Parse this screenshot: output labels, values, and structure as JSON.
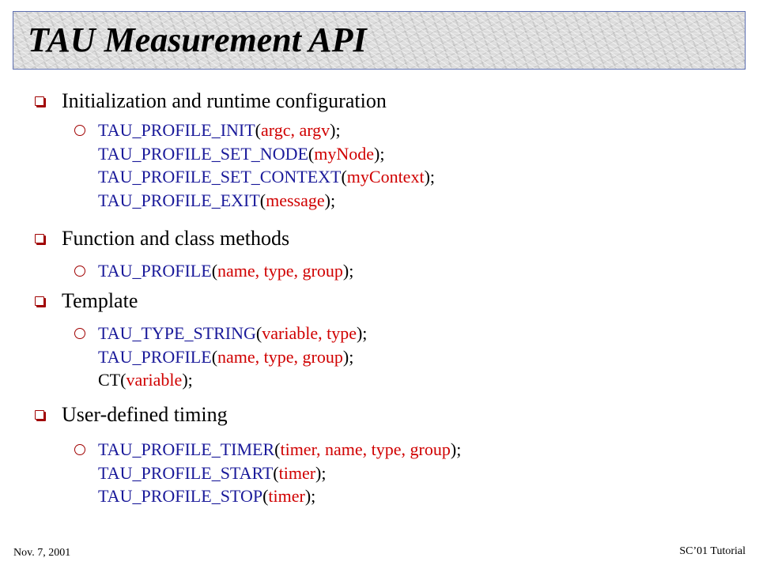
{
  "title": "TAU Measurement API",
  "sections": [
    {
      "heading": "Initialization and runtime configuration",
      "lines": [
        [
          {
            "fn": "TAU_PROFILE_INIT"
          },
          {
            "p": "("
          },
          {
            "arg": "argc, argv"
          },
          {
            "p": ");"
          }
        ],
        [
          {
            "fn": "TAU_PROFILE_SET_NODE"
          },
          {
            "p": "("
          },
          {
            "arg": "myNode"
          },
          {
            "p": ");"
          }
        ],
        [
          {
            "fn": "TAU_PROFILE_SET_CONTEXT"
          },
          {
            "p": "("
          },
          {
            "arg": "myContext"
          },
          {
            "p": ");"
          }
        ],
        [
          {
            "fn": "TAU_PROFILE_EXIT"
          },
          {
            "p": "("
          },
          {
            "arg": "message"
          },
          {
            "p": ");"
          }
        ]
      ]
    },
    {
      "heading": "Function and class methods",
      "lines": [
        [
          {
            "fn": "TAU_PROFILE"
          },
          {
            "p": "("
          },
          {
            "arg": "name, type, group"
          },
          {
            "p": ");"
          }
        ]
      ]
    },
    {
      "heading": "Template",
      "lines": [
        [
          {
            "fn": "TAU_TYPE_STRING"
          },
          {
            "p": "("
          },
          {
            "arg": "variable, type"
          },
          {
            "p": ");"
          }
        ],
        [
          {
            "fn": "TAU_PROFILE"
          },
          {
            "p": "("
          },
          {
            "arg": "name, type, group"
          },
          {
            "p": ");"
          }
        ],
        [
          {
            "p": "CT("
          },
          {
            "arg": "variable"
          },
          {
            "p": ");"
          }
        ]
      ]
    },
    {
      "heading": "User-defined timing",
      "lines": [
        [
          {
            "fn": "TAU_PROFILE_TIMER"
          },
          {
            "p": "("
          },
          {
            "arg": "timer, name, type, group"
          },
          {
            "p": ");"
          }
        ],
        [
          {
            "fn": "TAU_PROFILE_START"
          },
          {
            "p": "("
          },
          {
            "arg": "timer"
          },
          {
            "p": ");"
          }
        ],
        [
          {
            "fn": "TAU_PROFILE_STOP"
          },
          {
            "p": "("
          },
          {
            "arg": "timer"
          },
          {
            "p": ");"
          }
        ]
      ]
    }
  ],
  "footer": {
    "left": "Nov. 7, 2001",
    "right": "SC’01 Tutorial"
  },
  "colors": {
    "function_name": "#1a1a9a",
    "argument": "#d00000",
    "bullet": "#a00000",
    "title_border": "#5d6fb0"
  }
}
